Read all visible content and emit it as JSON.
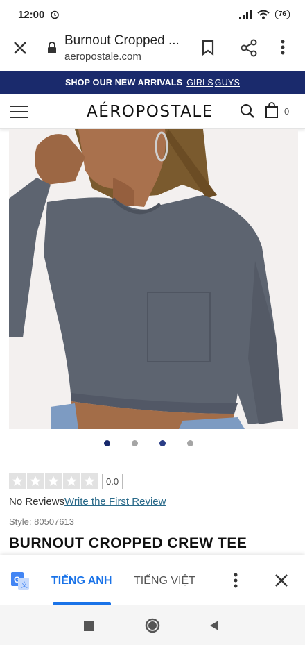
{
  "status_bar": {
    "time": "12:00",
    "battery": "76"
  },
  "browser": {
    "tab_title": "Burnout Cropped ...",
    "url": "aeropostale.com"
  },
  "promo": {
    "text": "SHOP OUR NEW ARRIVALS",
    "link_girls": "GIRLS",
    "link_guys": "GUYS"
  },
  "site": {
    "logo": "AÉROPOSTALE",
    "cart_count": "0"
  },
  "carousel": {
    "total": 4,
    "active_index": 0
  },
  "product": {
    "rating_score": "0.0",
    "reviews_text": "No Reviews",
    "write_review": "Write the First Review",
    "style": "Style: 80507613",
    "title": "BURNOUT CROPPED CREW TEE"
  },
  "translate": {
    "source_lang": "TIẾNG ANH",
    "target_lang": "TIẾNG VIỆT"
  },
  "colors": {
    "brand_navy": "#1a2a6c",
    "translate_blue": "#1a73e8",
    "tee_gray": "#5d6470"
  }
}
